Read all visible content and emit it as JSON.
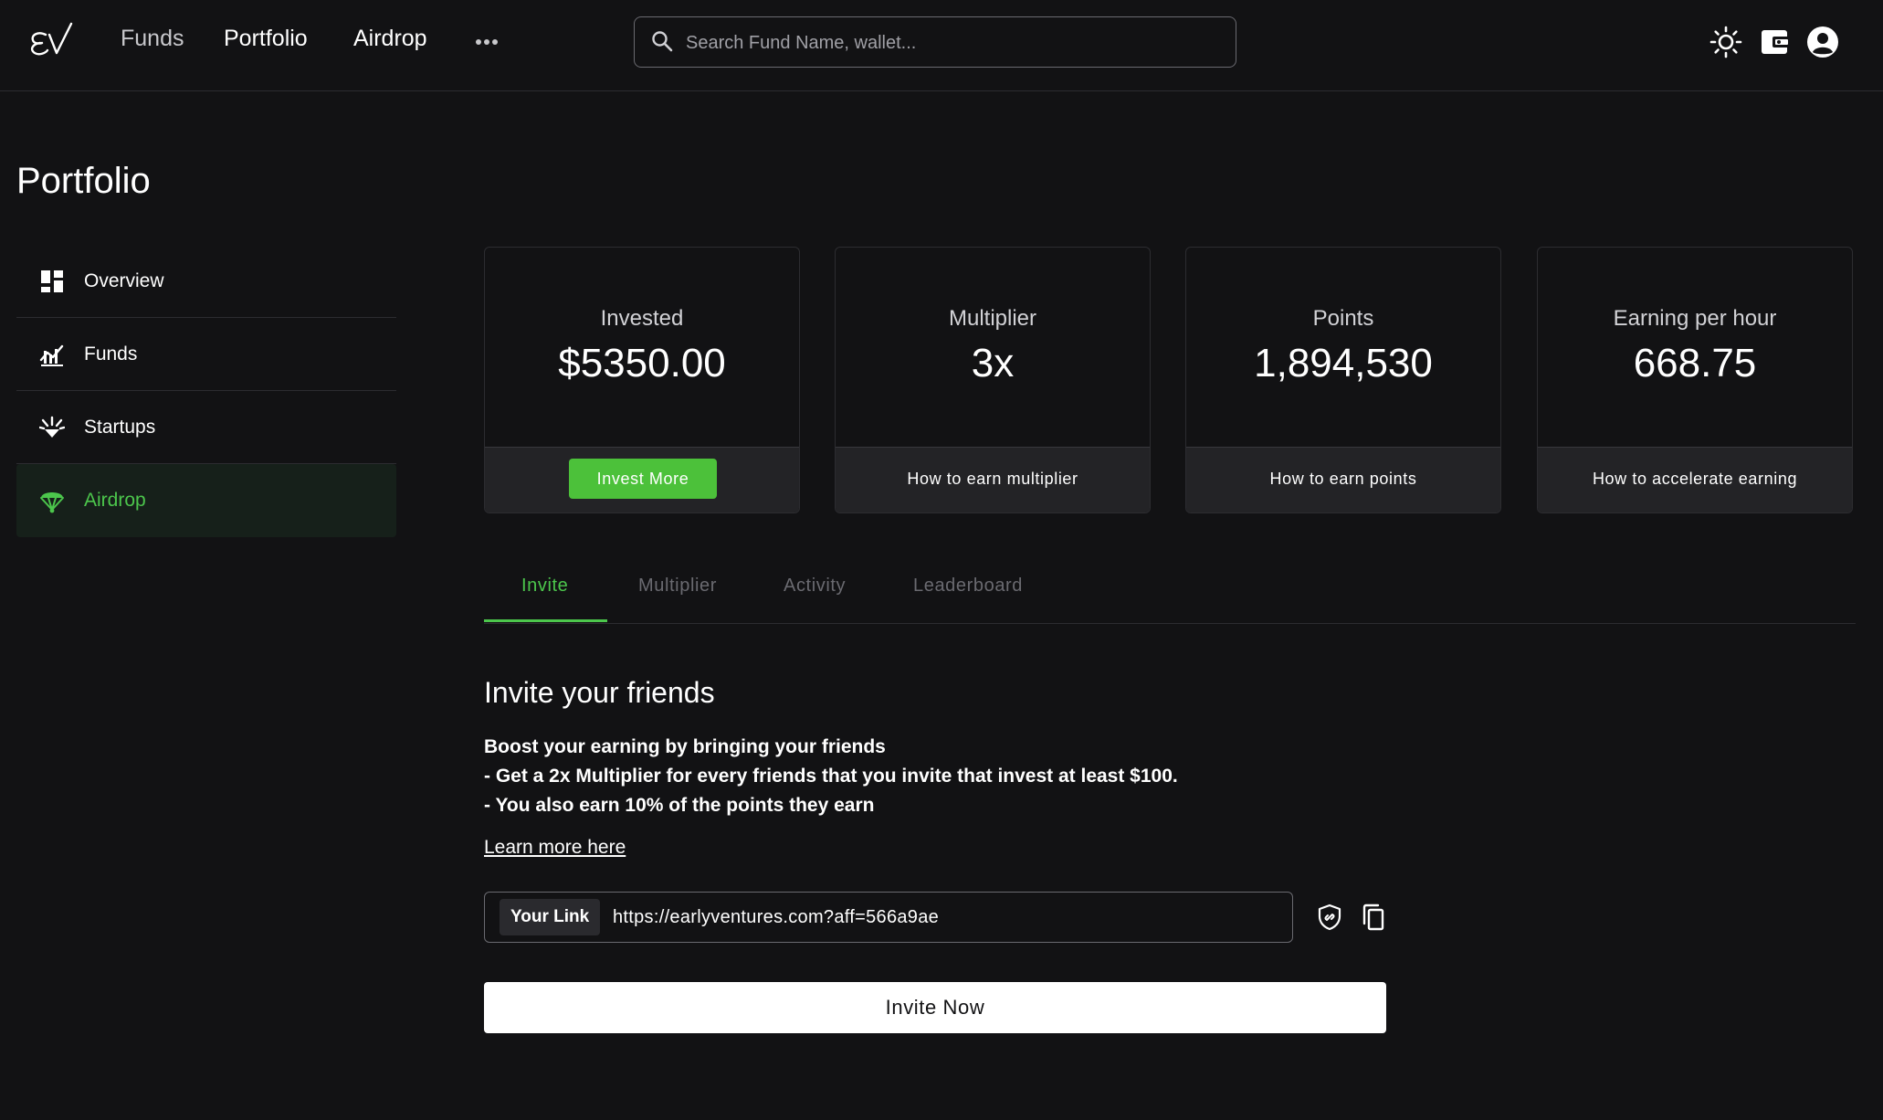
{
  "header": {
    "logo_alt": "EV",
    "nav": [
      {
        "label": "Funds",
        "active": false
      },
      {
        "label": "Portfolio",
        "active": true
      },
      {
        "label": "Airdrop",
        "active": true
      }
    ],
    "more_icon": "more-dots-icon",
    "search": {
      "placeholder": "Search Fund Name, wallet...",
      "value": "",
      "icon": "search-icon"
    },
    "right_icons": [
      "theme-sun-icon",
      "wallet-icon",
      "account-icon"
    ]
  },
  "page": {
    "title": "Portfolio"
  },
  "sidebar": {
    "items": [
      {
        "label": "Overview",
        "icon": "dashboard-grid-icon",
        "active": false
      },
      {
        "label": "Funds",
        "icon": "chart-growth-icon",
        "active": false
      },
      {
        "label": "Startups",
        "icon": "startups-spark-icon",
        "active": false
      },
      {
        "label": "Airdrop",
        "icon": "parachute-icon",
        "active": true
      }
    ]
  },
  "stats": [
    {
      "label": "Invested",
      "value": "$5350.00",
      "action": "Invest More"
    },
    {
      "label": "Multiplier",
      "value": "3x",
      "action": "How to earn multiplier"
    },
    {
      "label": "Points",
      "value": "1,894,530",
      "action": "How to earn points"
    },
    {
      "label": "Earning per hour",
      "value": "668.75",
      "action": "How to accelerate earning"
    }
  ],
  "tabs": [
    {
      "label": "Invite",
      "active": true
    },
    {
      "label": "Multiplier",
      "active": false
    },
    {
      "label": "Activity",
      "active": false
    },
    {
      "label": "Leaderboard",
      "active": false
    }
  ],
  "invite": {
    "title": "Invite your friends",
    "lines": [
      "Boost your earning by bringing your friends",
      "- Get a 2x Multiplier for every friends that you invite that invest at least $100.",
      "- You also earn 10% of the points they earn"
    ],
    "learn_more": "Learn more here",
    "link_label": "Your Link",
    "link_url": "https://earlyventures.com?aff=566a9ae",
    "actions": [
      "shield-link-icon",
      "copy-icon"
    ],
    "button": "Invite Now"
  },
  "colors": {
    "accent": "#4cc64c",
    "background": "#121214",
    "card_footer": "#232326",
    "border": "#2c2c30"
  }
}
